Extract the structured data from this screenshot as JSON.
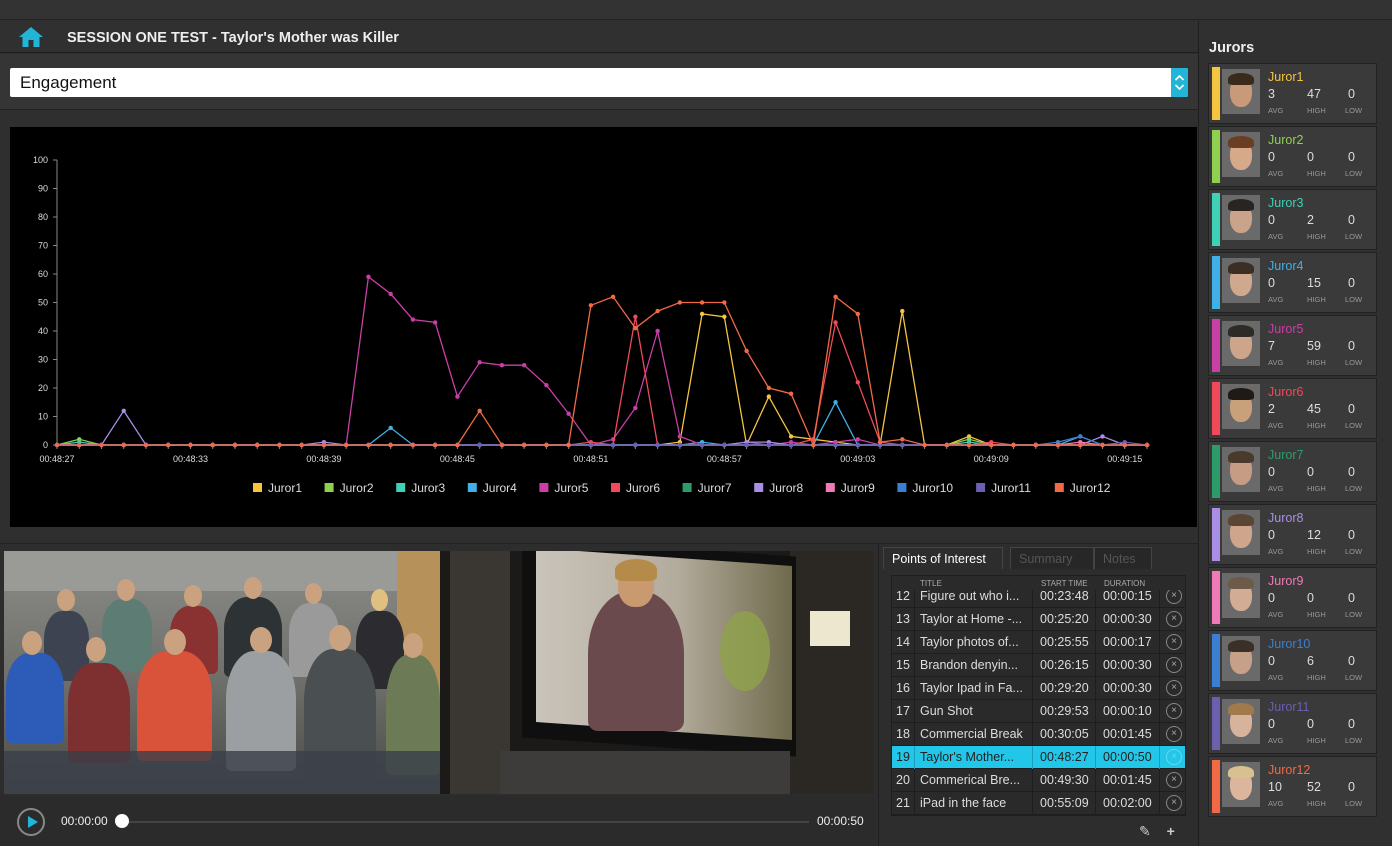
{
  "header": {
    "title": "SESSION ONE TEST - Taylor's Mother was Killer",
    "home_icon": "home-icon"
  },
  "metric_select": {
    "value": "Engagement"
  },
  "chart_data": {
    "type": "line",
    "x_labels": [
      "00:48:27",
      "00:48:33",
      "00:48:39",
      "00:48:45",
      "00:48:51",
      "00:48:57",
      "00:49:03",
      "00:49:09",
      "00:49:15"
    ],
    "y_ticks": [
      0,
      10,
      20,
      30,
      40,
      50,
      60,
      70,
      80,
      90,
      100
    ],
    "ylim": [
      0,
      100
    ],
    "x_points": 50,
    "legend_position": "bottom",
    "series": [
      {
        "name": "Juror1",
        "color": "#f5c542",
        "points": [
          [
            28,
            1
          ],
          [
            29,
            46
          ],
          [
            30,
            45
          ],
          [
            31,
            0
          ],
          [
            32,
            17
          ],
          [
            33,
            3
          ],
          [
            34,
            2
          ],
          [
            35,
            1
          ],
          [
            38,
            47
          ],
          [
            39,
            0
          ],
          [
            41,
            3
          ]
        ]
      },
      {
        "name": "Juror2",
        "color": "#8fd14f",
        "points": [
          [
            1,
            2
          ],
          [
            41,
            2
          ]
        ]
      },
      {
        "name": "Juror3",
        "color": "#3fd1b8",
        "points": [
          [
            1,
            1
          ],
          [
            41,
            1
          ]
        ]
      },
      {
        "name": "Juror4",
        "color": "#3fb0e8",
        "points": [
          [
            15,
            6
          ],
          [
            16,
            0
          ],
          [
            29,
            1
          ],
          [
            34,
            0
          ],
          [
            35,
            15
          ],
          [
            36,
            0
          ],
          [
            46,
            3
          ]
        ]
      },
      {
        "name": "Juror5",
        "color": "#c93fa6",
        "points": [
          [
            14,
            59
          ],
          [
            15,
            53
          ],
          [
            16,
            44
          ],
          [
            17,
            43
          ],
          [
            18,
            17
          ],
          [
            19,
            29
          ],
          [
            20,
            28
          ],
          [
            21,
            28
          ],
          [
            22,
            21
          ],
          [
            23,
            11
          ],
          [
            24,
            0
          ],
          [
            25,
            2
          ],
          [
            26,
            13
          ],
          [
            27,
            40
          ],
          [
            28,
            3
          ],
          [
            29,
            0
          ],
          [
            30,
            0
          ],
          [
            31,
            1
          ],
          [
            33,
            1
          ],
          [
            34,
            0
          ],
          [
            35,
            1
          ],
          [
            36,
            2
          ],
          [
            37,
            0
          ]
        ]
      },
      {
        "name": "Juror6",
        "color": "#f04a5a",
        "points": [
          [
            24,
            1
          ],
          [
            25,
            0
          ],
          [
            26,
            45
          ],
          [
            27,
            0
          ],
          [
            33,
            0
          ],
          [
            34,
            2
          ],
          [
            35,
            43
          ],
          [
            36,
            22
          ],
          [
            37,
            1
          ],
          [
            38,
            0
          ],
          [
            42,
            1
          ],
          [
            43,
            0
          ]
        ]
      },
      {
        "name": "Juror7",
        "color": "#2e9c6a",
        "points": [
          [
            0,
            0
          ],
          [
            1,
            0
          ],
          [
            49,
            0
          ]
        ]
      },
      {
        "name": "Juror8",
        "color": "#a98ee8",
        "points": [
          [
            2,
            0
          ],
          [
            3,
            12
          ],
          [
            4,
            0
          ],
          [
            12,
            1
          ],
          [
            13,
            0
          ],
          [
            31,
            1
          ],
          [
            32,
            1
          ],
          [
            33,
            0
          ],
          [
            47,
            3
          ],
          [
            48,
            0
          ]
        ]
      },
      {
        "name": "Juror9",
        "color": "#f07ab6",
        "points": [
          [
            46,
            1
          ],
          [
            47,
            0
          ]
        ]
      },
      {
        "name": "Juror10",
        "color": "#3a7fd0",
        "points": [
          [
            45,
            1
          ],
          [
            46,
            3
          ],
          [
            47,
            0
          ]
        ]
      },
      {
        "name": "Juror11",
        "color": "#6b5fb0",
        "points": [
          [
            48,
            1
          ],
          [
            49,
            0
          ]
        ]
      },
      {
        "name": "Juror12",
        "color": "#f26a45",
        "points": [
          [
            18,
            0
          ],
          [
            19,
            12
          ],
          [
            20,
            0
          ],
          [
            23,
            0
          ],
          [
            24,
            49
          ],
          [
            25,
            52
          ],
          [
            26,
            41
          ],
          [
            27,
            47
          ],
          [
            28,
            50
          ],
          [
            29,
            50
          ],
          [
            30,
            50
          ],
          [
            31,
            33
          ],
          [
            32,
            20
          ],
          [
            33,
            18
          ],
          [
            34,
            0
          ],
          [
            35,
            52
          ],
          [
            36,
            46
          ],
          [
            37,
            1
          ],
          [
            38,
            2
          ],
          [
            39,
            0
          ],
          [
            41,
            0
          ],
          [
            42,
            0
          ]
        ]
      }
    ]
  },
  "player": {
    "current_time": "00:00:00",
    "duration": "00:00:50",
    "progress": 0
  },
  "poi": {
    "tabs": [
      "Points of Interest",
      "Summary",
      "Notes"
    ],
    "columns": [
      "TITLE",
      "START TIME",
      "DURATION"
    ],
    "rows": [
      {
        "num": "12",
        "title": "Figure out who i...",
        "start": "00:23:48",
        "duration": "00:00:15"
      },
      {
        "num": "13",
        "title": "Taylor at Home -...",
        "start": "00:25:20",
        "duration": "00:00:30"
      },
      {
        "num": "14",
        "title": "Taylor photos of...",
        "start": "00:25:55",
        "duration": "00:00:17"
      },
      {
        "num": "15",
        "title": "Brandon denyin...",
        "start": "00:26:15",
        "duration": "00:00:30"
      },
      {
        "num": "16",
        "title": "Taylor Ipad in Fa...",
        "start": "00:29:20",
        "duration": "00:00:30"
      },
      {
        "num": "17",
        "title": "Gun Shot",
        "start": "00:29:53",
        "duration": "00:00:10"
      },
      {
        "num": "18",
        "title": "Commercial Break",
        "start": "00:30:05",
        "duration": "00:01:45"
      },
      {
        "num": "19",
        "title": "Taylor's Mother...",
        "start": "00:48:27",
        "duration": "00:00:50"
      },
      {
        "num": "20",
        "title": "Commerical Bre...",
        "start": "00:49:30",
        "duration": "00:01:45"
      },
      {
        "num": "21",
        "title": "iPad in the face",
        "start": "00:55:09",
        "duration": "00:02:00"
      }
    ],
    "selected_row": "19"
  },
  "jurors": {
    "title": "Jurors",
    "stat_labels": [
      "AVG",
      "HIGH",
      "LOW"
    ],
    "list": [
      {
        "name": "Juror1",
        "color": "#f5c542",
        "avg": "3",
        "high": "47",
        "low": "0",
        "skin": "#c89a7a",
        "hair": "#3a2a1c"
      },
      {
        "name": "Juror2",
        "color": "#8fd14f",
        "avg": "0",
        "high": "0",
        "low": "0",
        "skin": "#d6a98a",
        "hair": "#6a3e22"
      },
      {
        "name": "Juror3",
        "color": "#3fd1b8",
        "avg": "0",
        "high": "2",
        "low": "0",
        "skin": "#c9a48a",
        "hair": "#2a2420"
      },
      {
        "name": "Juror4",
        "color": "#3fb0e8",
        "avg": "0",
        "high": "15",
        "low": "0",
        "skin": "#cfa88e",
        "hair": "#3b2f25"
      },
      {
        "name": "Juror5",
        "color": "#c93fa6",
        "avg": "7",
        "high": "59",
        "low": "0",
        "skin": "#cca58a",
        "hair": "#2e2a26"
      },
      {
        "name": "Juror6",
        "color": "#f04a5a",
        "avg": "2",
        "high": "45",
        "low": "0",
        "skin": "#c8a07a",
        "hair": "#1f1a16"
      },
      {
        "name": "Juror7",
        "color": "#2e9c6a",
        "avg": "0",
        "high": "0",
        "low": "0",
        "skin": "#c69c84",
        "hair": "#4a3a2c"
      },
      {
        "name": "Juror8",
        "color": "#a98ee8",
        "avg": "0",
        "high": "12",
        "low": "0",
        "skin": "#cfa58c",
        "hair": "#5a4634"
      },
      {
        "name": "Juror9",
        "color": "#f07ab6",
        "avg": "0",
        "high": "0",
        "low": "0",
        "skin": "#d2ac94",
        "hair": "#6e5a48"
      },
      {
        "name": "Juror10",
        "color": "#3a7fd0",
        "avg": "0",
        "high": "6",
        "low": "0",
        "skin": "#c7a08a",
        "hair": "#3a3028"
      },
      {
        "name": "Juror11",
        "color": "#6b5fb0",
        "avg": "0",
        "high": "0",
        "low": "0",
        "skin": "#d6b39a",
        "hair": "#a07a4a"
      },
      {
        "name": "Juror12",
        "color": "#f26a45",
        "avg": "10",
        "high": "52",
        "low": "0",
        "skin": "#dcb69c",
        "hair": "#d8c090"
      }
    ]
  }
}
